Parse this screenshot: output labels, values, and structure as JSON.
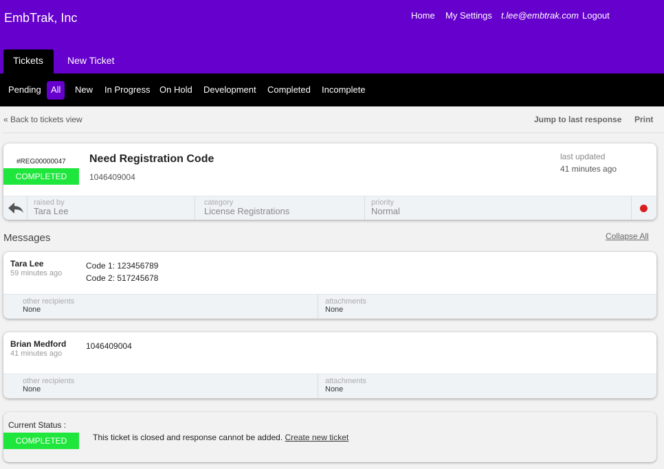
{
  "header": {
    "brand": "EmbTrak, Inc",
    "links": {
      "home": "Home",
      "settings": "My Settings",
      "email": "t.lee@embtrak.com",
      "logout": "Logout"
    },
    "tabs": {
      "tickets": "Tickets",
      "new_ticket": "New Ticket"
    }
  },
  "filters": {
    "pending": "Pending",
    "all": "All",
    "new": "New",
    "in_progress": "In Progress",
    "on_hold": "On Hold",
    "development": "Development",
    "completed": "Completed",
    "incomplete": "Incomplete"
  },
  "subnav": {
    "back": "« Back to tickets view",
    "jump": "Jump to last response",
    "print": "Print"
  },
  "ticket": {
    "id": "#REG00000047",
    "status": "COMPLETED",
    "title": "Need Registration Code",
    "subtitle": "1046409004",
    "last_updated_label": "last updated",
    "last_updated_value": "41 minutes ago",
    "raised_by_label": "raised by",
    "raised_by_value": "Tara Lee",
    "category_label": "category",
    "category_value": "License Registrations",
    "priority_label": "priority",
    "priority_value": "Normal",
    "priority_color": "#d81e1e"
  },
  "messages": {
    "title": "Messages",
    "collapse": "Collapse All",
    "items": [
      {
        "author": "Tara Lee",
        "time": "59 minutes ago",
        "line1": "Code 1: 123456789",
        "line2": "Code 2: 517245678",
        "recipients_label": "other recipients",
        "recipients_value": "None",
        "attachments_label": "attachments",
        "attachments_value": "None"
      },
      {
        "author": "Brian Medford",
        "time": "41 minutes ago",
        "line1": "1046409004",
        "recipients_label": "other recipients",
        "recipients_value": "None",
        "attachments_label": "attachments",
        "attachments_value": "None"
      }
    ]
  },
  "status_panel": {
    "label": "Current Status :",
    "status": "COMPLETED",
    "text": "This ticket is closed and response cannot be added. ",
    "link": "Create new ticket"
  },
  "colors": {
    "brand": "#6600cc",
    "completed": "#1fe63c"
  }
}
